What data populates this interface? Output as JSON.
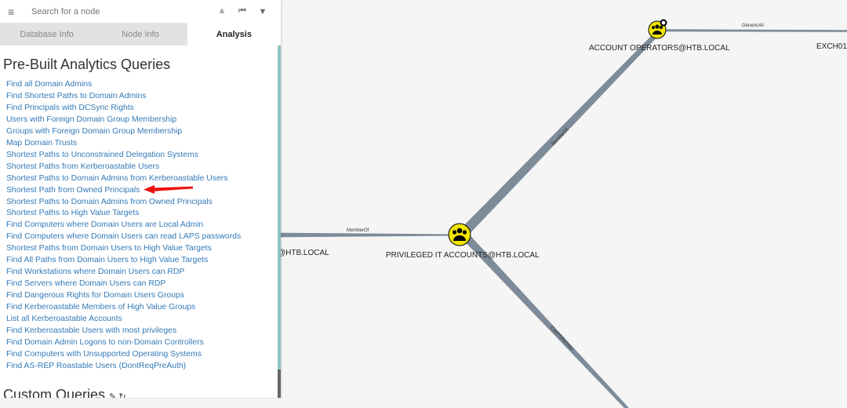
{
  "sidebar": {
    "search": {
      "placeholder": "Search for a node"
    },
    "toolbar": {
      "menu_icon": "≡",
      "path_icon": "⩓",
      "back_icon": "⏮",
      "filter_icon": "▼"
    },
    "tabs": [
      {
        "label": "Database Info",
        "active": false
      },
      {
        "label": "Node Info",
        "active": false
      },
      {
        "label": "Analysis",
        "active": true
      }
    ],
    "prebuilt_title": "Pre-Built Analytics Queries",
    "queries": [
      "Find all Domain Admins",
      "Find Shortest Paths to Domain Admins",
      "Find Principals with DCSync Rights",
      "Users with Foreign Domain Group Membership",
      "Groups with Foreign Domain Group Membership",
      "Map Domain Trusts",
      "Shortest Paths to Unconstrained Delegation Systems",
      "Shortest Paths from Kerberoastable Users",
      "Shortest Paths to Domain Admins from Kerberoastable Users",
      "Shortest Path from Owned Principals",
      "Shortest Paths to Domain Admins from Owned Principals",
      "Shortest Paths to High Value Targets",
      "Find Computers where Domain Users are Local Admin",
      "Find Computers where Domain Users can read LAPS passwords",
      "Shortest Paths from Domain Users to High Value Targets",
      "Find All Paths from Domain Users to High Value Targets",
      "Find Workstations where Domain Users can RDP",
      "Find Servers where Domain Users can RDP",
      "Find Dangerous Rights for Domain Users Groups",
      "Find Kerberoastable Members of High Value Groups",
      "List all Kerberoastable Accounts",
      "Find Kerberoastable Users with most privileges",
      "Find Domain Admin Logons to non-Domain Controllers",
      "Find Computers with Unsupported Operating Systems",
      "Find AS-REP Roastable Users (DontReqPreAuth)"
    ],
    "custom_title": "Custom Queries",
    "custom_icons": "✎ ↻"
  },
  "graph": {
    "nodes": {
      "account_operators": "ACCOUNT OPERATORS@HTB.LOCAL",
      "privileged_it": "PRIVILEGED IT ACCOUNTS@HTB.LOCAL",
      "left_partial": "@HTB.LOCAL",
      "exch_partial": "EXCH01"
    },
    "edges": {
      "generic_all": "GenericAll",
      "member_of_upper": "MemberOf",
      "member_of_left": "MemberOf",
      "can_ps_remote": "CanPSRemote"
    },
    "colors": {
      "node_fill": "#f2e500",
      "node_stroke": "#000000",
      "edge": "#7e8b98",
      "annotation": "#ee1111"
    }
  }
}
